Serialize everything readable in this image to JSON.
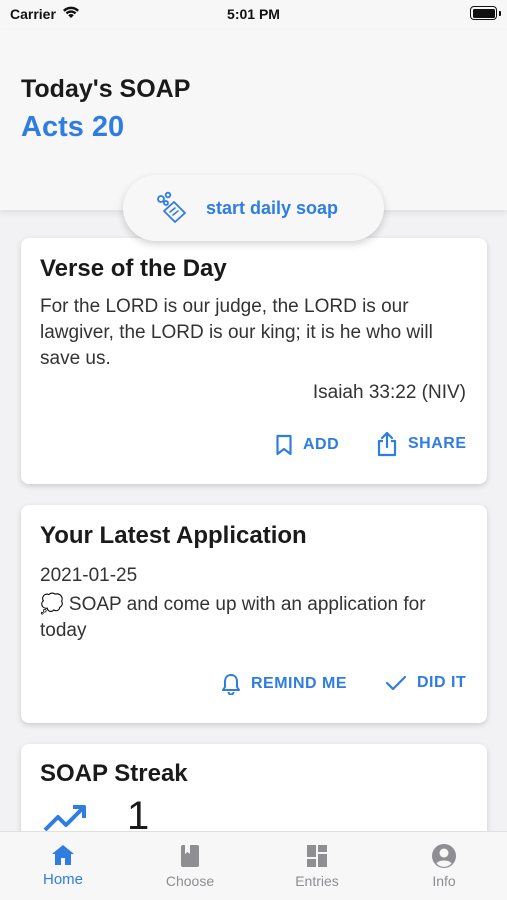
{
  "status_bar": {
    "carrier": "Carrier",
    "time": "5:01 PM"
  },
  "header": {
    "title": "Today's SOAP",
    "subtitle": "Acts 20"
  },
  "start_button": {
    "label": "start daily soap"
  },
  "verse_card": {
    "title": "Verse of the Day",
    "text": "For the LORD is our judge, the LORD is our lawgiver, the LORD is our king; it is he who will save us.",
    "reference": "Isaiah 33:22 (NIV)",
    "add_label": "ADD",
    "share_label": "SHARE"
  },
  "application_card": {
    "title": "Your Latest Application",
    "date": "2021-01-25",
    "text": "💭 SOAP and come up with an application for today",
    "remind_label": "REMIND ME",
    "did_it_label": "DID IT"
  },
  "streak_card": {
    "title": "SOAP Streak",
    "count": "1"
  },
  "tabs": [
    {
      "label": "Home",
      "icon": "home-icon",
      "active": true
    },
    {
      "label": "Choose",
      "icon": "book-icon",
      "active": false
    },
    {
      "label": "Entries",
      "icon": "grid-icon",
      "active": false
    },
    {
      "label": "Info",
      "icon": "account-icon",
      "active": false
    }
  ],
  "colors": {
    "accent": "#2f7de1",
    "inactive": "#8e8e93",
    "background": "#f2f2f4"
  }
}
